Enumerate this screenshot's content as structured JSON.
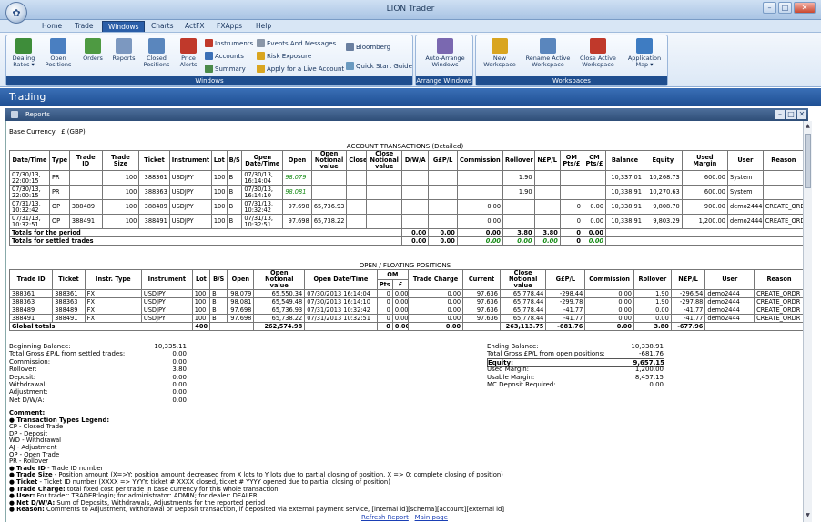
{
  "window": {
    "title": "LION Trader",
    "orb_icon": "lion-icon"
  },
  "menu": {
    "items": [
      "Home",
      "Trade",
      "Windows",
      "Charts",
      "ActFX",
      "FXApps",
      "Help"
    ],
    "active": "Windows"
  },
  "ribbon": {
    "windows_group": {
      "label": "Windows",
      "buttons": [
        {
          "label1": "Dealing",
          "label2": "Rates ▾",
          "icon": "bar-chart-icon",
          "color": "#3e8d3a"
        },
        {
          "label1": "Open",
          "label2": "Positions",
          "icon": "open-positions-icon",
          "color": "#4a7fc1"
        },
        {
          "label1": "Orders",
          "label2": "",
          "icon": "orders-icon",
          "color": "#4e9a42"
        },
        {
          "label1": "Reports",
          "label2": "",
          "icon": "reports-icon",
          "color": "#7c98c0"
        },
        {
          "label1": "Closed",
          "label2": "Positions",
          "icon": "closed-positions-icon",
          "color": "#5a86bd"
        },
        {
          "label1": "Price",
          "label2": "Alerts",
          "icon": "price-alerts-icon",
          "color": "#c0392b"
        }
      ],
      "small": [
        {
          "label": "Instruments",
          "icon": "instruments-icon",
          "color": "#c0392b"
        },
        {
          "label": "Accounts",
          "icon": "accounts-icon",
          "color": "#3a6fb6"
        },
        {
          "label": "Summary",
          "icon": "summary-icon",
          "color": "#4a8a4a"
        },
        {
          "label": "Events And Messages",
          "icon": "events-icon",
          "color": "#8a96a8"
        },
        {
          "label": "Risk Exposure",
          "icon": "risk-icon",
          "color": "#d9a520"
        },
        {
          "label": "Apply for a Live Account",
          "icon": "apply-icon",
          "color": "#d9a520"
        },
        {
          "label": "Bloomberg",
          "icon": "bloomberg-icon",
          "color": "#6a7fa0"
        },
        {
          "label": "Quick Start Guide",
          "icon": "guide-icon",
          "color": "#6a9ac0"
        }
      ]
    },
    "arrange_group": {
      "label": "Arrange Windows",
      "button": {
        "label1": "Auto-Arrange",
        "label2": "Windows",
        "icon": "auto-arrange-icon",
        "color": "#7a68b0"
      }
    },
    "workspaces_group": {
      "label": "Workspaces",
      "buttons": [
        {
          "label1": "New",
          "label2": "Workspace",
          "icon": "new-workspace-icon",
          "color": "#d9a520"
        },
        {
          "label1": "Rename Active",
          "label2": "Workspace",
          "icon": "rename-workspace-icon",
          "color": "#5a86bd"
        },
        {
          "label1": "Close Active",
          "label2": "Workspace",
          "icon": "close-workspace-icon",
          "color": "#c0392b"
        },
        {
          "label1": "Application",
          "label2": "Map ▾",
          "icon": "application-map-icon",
          "color": "#3e7cc2"
        }
      ]
    }
  },
  "trading_bar": {
    "title": "Trading"
  },
  "reports_panel": {
    "title": "Reports"
  },
  "report": {
    "base_currency_label": "Base Currency:",
    "base_currency_value": "£ (GBP)",
    "account_transactions": {
      "title": "ACCOUNT TRANSACTIONS (Detailed)",
      "headers": [
        "Date/Time",
        "Type",
        "Trade ID",
        "Trade Size",
        "Ticket",
        "Instrument",
        "Lot",
        "B/S",
        "Open Date/Time",
        "Open",
        "Open Notional value",
        "Close",
        "Close Notional value",
        "D/W/A",
        "G£P/L",
        "Commission",
        "Rollover",
        "N£P/L",
        "OM Pts/£",
        "CM Pts/£",
        "Balance",
        "Equity",
        "Used Margin",
        "User",
        "Reason"
      ],
      "rows": [
        [
          "07/30/13, 22:00:15",
          "PR",
          "",
          "100",
          "388361",
          "USDJPY",
          "100",
          "B",
          "07/30/13, 16:14:04",
          "98.079",
          "",
          "",
          "",
          "",
          "",
          "",
          "1.90",
          "",
          "",
          "",
          "10,337.01",
          "10,268.73",
          "600.00",
          "System",
          ""
        ],
        [
          "07/30/13, 22:00:15",
          "PR",
          "",
          "100",
          "388363",
          "USDJPY",
          "100",
          "B",
          "07/30/13, 16:14:10",
          "98.081",
          "",
          "",
          "",
          "",
          "",
          "",
          "1.90",
          "",
          "",
          "",
          "10,338.91",
          "10,270.63",
          "600.00",
          "System",
          ""
        ],
        [
          "07/31/13, 10:32:42",
          "OP",
          "388489",
          "100",
          "388489",
          "USDJPY",
          "100",
          "B",
          "07/31/13, 10:32:42",
          "97.698",
          "65,736.93",
          "",
          "",
          "",
          "",
          "0.00",
          "",
          "",
          "0",
          "0.00",
          "10,338.91",
          "9,808.70",
          "900.00",
          "demo2444",
          "CREATE_ORDR"
        ],
        [
          "07/31/13, 10:32:51",
          "OP",
          "388491",
          "100",
          "388491",
          "USDJPY",
          "100",
          "B",
          "07/31/13, 10:32:51",
          "97.698",
          "65,738.22",
          "",
          "",
          "",
          "",
          "0.00",
          "",
          "",
          "0",
          "0.00",
          "10,338.91",
          "9,803.29",
          "1,200.00",
          "demo2444",
          "CREATE_ORDR"
        ]
      ],
      "totals": [
        {
          "label": "Totals for the period",
          "dwa": "0.00",
          "gpl": "0.00",
          "commission": "0.00",
          "rollover": "3.80",
          "npl": "3.80",
          "om": "0",
          "om2": "0.00",
          "cm": "0",
          "cm2": "0.00"
        },
        {
          "label": "Totals for settled trades",
          "dwa": "0.00",
          "gpl": "0.00",
          "commission": "0.00",
          "rollover": "0.00",
          "npl": "0.00",
          "om": "0",
          "om2": "0.00",
          "cm": "0",
          "cm2": "0.00"
        }
      ]
    },
    "open_positions": {
      "title": "OPEN / FLOATING POSITIONS",
      "headers": [
        "Trade ID",
        "Ticket",
        "Instr. Type",
        "Instrument",
        "Lot",
        "B/S",
        "Open",
        "Open Notional value",
        "Open Date/Time",
        "OM",
        "Trade Charge",
        "Current",
        "Close Notional value",
        "G£P/L",
        "Commission",
        "Rollover",
        "N£P/L",
        "User",
        "Reason"
      ],
      "om_sub": [
        "Pts",
        "£"
      ],
      "rows": [
        [
          "388361",
          "388361",
          "FX",
          "USDJPY",
          "100",
          "B",
          "98.079",
          "65,550.34",
          "07/30/2013 16:14:04",
          "0",
          "0.00",
          "0.00",
          "97.636",
          "65,778.44",
          "-298.44",
          "0.00",
          "1.90",
          "-296.54",
          "demo2444",
          "CREATE_ORDR"
        ],
        [
          "388363",
          "388363",
          "FX",
          "USDJPY",
          "100",
          "B",
          "98.081",
          "65,549.48",
          "07/30/2013 16:14:10",
          "0",
          "0.00",
          "0.00",
          "97.636",
          "65,778.44",
          "-299.78",
          "0.00",
          "1.90",
          "-297.88",
          "demo2444",
          "CREATE_ORDR"
        ],
        [
          "388489",
          "388489",
          "FX",
          "USDJPY",
          "100",
          "B",
          "97.698",
          "65,736.93",
          "07/31/2013 10:32:42",
          "0",
          "0.00",
          "0.00",
          "97.636",
          "65,778.44",
          "-41.77",
          "0.00",
          "0.00",
          "-41.77",
          "demo2444",
          "CREATE_ORDR"
        ],
        [
          "388491",
          "388491",
          "FX",
          "USDJPY",
          "100",
          "B",
          "97.698",
          "65,738.22",
          "07/31/2013 10:32:51",
          "0",
          "0.00",
          "0.00",
          "97.636",
          "65,778.44",
          "-41.77",
          "0.00",
          "0.00",
          "-41.77",
          "demo2444",
          "CREATE_ORDR"
        ]
      ],
      "global_totals": {
        "label": "Global totals",
        "lot": "400",
        "open_notional": "262,574.98",
        "pts": "0",
        "pounds": "0.00",
        "trade_charge": "0.00",
        "close_notional": "263,113.75",
        "gpl": "-681.76",
        "commission": "0.00",
        "rollover": "3.80",
        "npl": "-677.96"
      }
    },
    "summary_left": [
      {
        "label": "Beginning Balance:",
        "value": "10,335.11"
      },
      {
        "label": "Total Gross £P/L from settled trades:",
        "value": "0.00"
      },
      {
        "label": "Commission:",
        "value": "0.00"
      },
      {
        "label": "Rollover:",
        "value": "3.80"
      },
      {
        "label": "Deposit:",
        "value": "0.00"
      },
      {
        "label": "Withdrawal:",
        "value": "0.00"
      },
      {
        "label": "Adjustment:",
        "value": "0.00"
      },
      {
        "label": "Net D/W/A:",
        "value": "0.00"
      }
    ],
    "summary_right": [
      {
        "label": "Ending Balance:",
        "value": "10,338.91"
      },
      {
        "label": "Total Gross £P/L from open positions:",
        "value": "-681.76"
      },
      {
        "label": "Equity:",
        "value": "9,657.15"
      },
      {
        "label": "Used Margin:",
        "value": "1,200.00"
      },
      {
        "label": "Usable Margin:",
        "value": "8,457.15"
      },
      {
        "label": "MC Deposit Required:",
        "value": "0.00"
      }
    ],
    "comment": {
      "title": "Comment:",
      "legend_title": "Transaction Types Legend:",
      "types": [
        "CP - Closed Trade",
        "DP - Deposit",
        "WD - Withdrawal",
        "AJ - Adjustment",
        "OP - Open Trade",
        "PR - Rollover"
      ],
      "bullets": [
        {
          "key": "Trade ID",
          "text": " - Trade ID number"
        },
        {
          "key": "Trade Size",
          "text": " - Position amount (X=>Y: position amount decreased from X lots to Y lots due to partial closing of position. X => 0: complete closing of position)"
        },
        {
          "key": "Ticket",
          "text": " - Ticket ID number (XXXX => YYYY: ticket # XXXX closed, ticket # YYYY opened due to partial closing of position)"
        },
        {
          "key": "Trade Charge:",
          "text": " total fixed cost per trade in base currency for this whole transaction"
        },
        {
          "key": "User:",
          "text": " For trader: TRADER:login; for administrator: ADMIN; for dealer: DEALER"
        },
        {
          "key": "Net D/W/A:",
          "text": " Sum of Deposits, Withdrawals, Adjustments for the reported period"
        },
        {
          "key": "Reason:",
          "text": " Comments to Adjustment, Withdrawal or Deposit transaction, if deposited via external payment service, [internal id][schema][account][external id]"
        }
      ]
    },
    "links": {
      "refresh": "Refresh Report",
      "main": "Main page"
    }
  }
}
